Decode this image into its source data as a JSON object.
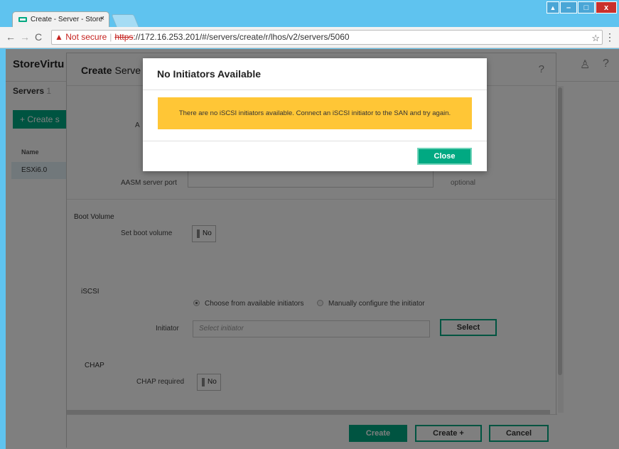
{
  "browser": {
    "tab_title": "Create - Server - Store'",
    "tab_close": "×",
    "not_secure": "Not secure",
    "url_scheme": "https",
    "url_rest": "://172.16.253.201/#/servers/create/r/lhos/v2/servers/5060"
  },
  "app": {
    "brand": "StoreVirtu",
    "servers_label": "Servers",
    "servers_count": "1",
    "create_button": "+ Create s",
    "name_column": "Name",
    "row_name": "ESXi6.0",
    "help_glyph": "?"
  },
  "panel": {
    "title_bold": "Create",
    "title_rest": " Serve",
    "help_glyph": "?",
    "aasm_initial": "A",
    "aasm_server_port_label": "AASM server port",
    "optional": "optional",
    "boot_volume_section": "Boot Volume",
    "set_boot_volume_label": "Set boot volume",
    "boot_toggle": "No",
    "iscsi_section": "iSCSI",
    "radio_choose": "Choose from available initiators",
    "radio_manual": "Manually configure the initiator",
    "initiator_label": "Initiator",
    "initiator_placeholder": "Select initiator",
    "select_button": "Select",
    "chap_section": "CHAP",
    "chap_required_label": "CHAP required",
    "chap_toggle": "No",
    "create_button": "Create",
    "create_plus_button": "Create +",
    "cancel_button": "Cancel"
  },
  "modal": {
    "title": "No Initiators Available",
    "message": "There are no iSCSI initiators available. Connect an iSCSI initiator to the SAN and try again.",
    "close_button": "Close"
  },
  "colors": {
    "accent": "#01a982",
    "warning": "#ffc636",
    "chrome": "#5fc3ef"
  }
}
